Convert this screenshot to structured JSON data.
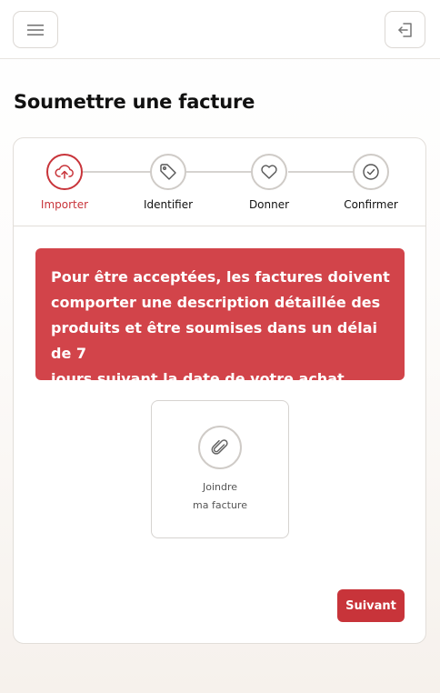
{
  "header": {
    "menu_icon": "hamburger-menu-icon",
    "logout_icon": "logout-icon"
  },
  "page": {
    "title": "Soumettre une facture"
  },
  "stepper": {
    "steps": [
      {
        "label": "Importer",
        "icon": "upload-cloud-icon",
        "active": true
      },
      {
        "label": "Identifier",
        "icon": "tag-icon",
        "active": false
      },
      {
        "label": "Donner",
        "icon": "heart-icon",
        "active": false
      },
      {
        "label": "Confirmer",
        "icon": "check-circle-icon",
        "active": false
      }
    ]
  },
  "alert": {
    "lines": [
      "Pour être acceptées, les factures doivent",
      "comporter une description détaillée des",
      "produits et être soumises dans un délai de 7",
      "jours suivant la date de votre achat."
    ]
  },
  "attach": {
    "icon": "paperclip-icon",
    "line1": "Joindre",
    "line2": "ma facture"
  },
  "actions": {
    "next_label": "Suivant"
  },
  "colors": {
    "accent": "#c8343a",
    "alert_bg": "#d2444a"
  }
}
